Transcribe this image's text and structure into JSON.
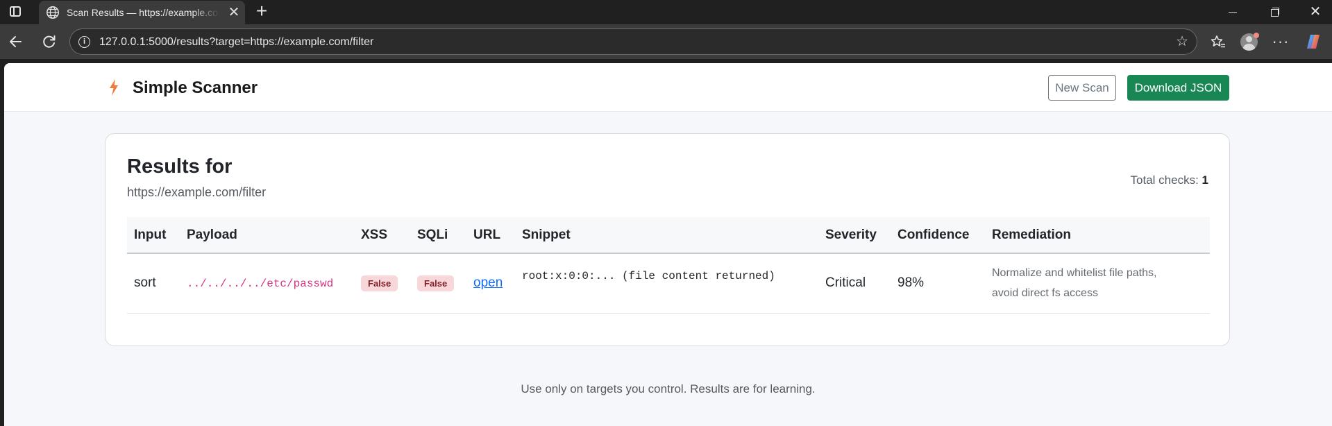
{
  "browser": {
    "tab_title": "Scan Results — https://example.com/filter",
    "url": "127.0.0.1:5000/results?target=https://example.com/filter"
  },
  "icons": {
    "sidebar": "sidebar-toggle-icon",
    "favicon": "globe-icon",
    "close": "close-icon",
    "new_tab": "plus-icon",
    "back": "arrow-left-icon",
    "reload": "reload-icon",
    "info": "info-icon",
    "star": "star-icon",
    "favorites": "favorites-icon",
    "profile": "avatar-icon",
    "more": "more-icon",
    "copilot": "copilot-icon",
    "brand": "bolt-icon"
  },
  "app": {
    "brand": "Simple Scanner",
    "new_scan_label": "New Scan",
    "download_label": "Download JSON"
  },
  "results": {
    "title": "Results for",
    "target": "https://example.com/filter",
    "total_checks_label": "Total checks:",
    "total_checks_value": "1",
    "columns": [
      "Input",
      "Payload",
      "XSS",
      "SQLi",
      "URL",
      "Snippet",
      "Severity",
      "Confidence",
      "Remediation"
    ],
    "rows": [
      {
        "input": "sort",
        "payload": "../../../../etc/passwd",
        "xss": "False",
        "sqli": "False",
        "url": "open",
        "snippet": "root:x:0:0:... (file content returned)",
        "severity": "Critical",
        "confidence": "98%",
        "remediation_line1": "Normalize and whitelist file paths,",
        "remediation_line2": "avoid direct fs access"
      }
    ]
  },
  "footer": {
    "note": "Use only on targets you control. Results are for learning."
  },
  "colors": {
    "success": "#198754",
    "danger_badge_bg": "#f8d7da",
    "danger_badge_text": "#842029",
    "payload_pink": "#d63384",
    "link_blue": "#0d6efd",
    "brand_bolt": "#f07a3a"
  }
}
